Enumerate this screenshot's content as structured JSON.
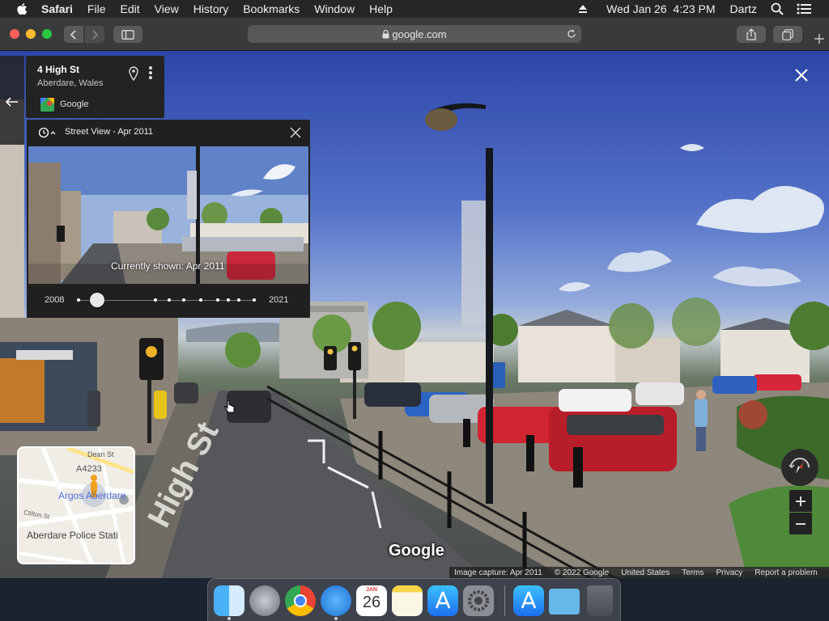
{
  "menubar": {
    "app_name": "Safari",
    "items": [
      "File",
      "Edit",
      "View",
      "History",
      "Bookmarks",
      "Window",
      "Help"
    ],
    "datetime": "Wed Jan 26  4:23 PM",
    "user": "Dartz"
  },
  "browser": {
    "url": "google.com"
  },
  "place_card": {
    "title": "4 High St",
    "subtitle": "Aberdare, Wales",
    "source": "Google"
  },
  "time_panel": {
    "title": "Street View - Apr 2011",
    "caption": "Currently shown: Apr 2011",
    "start_year": "2008",
    "end_year": "2021",
    "selected_fraction": 0.105
  },
  "scene": {
    "road_label": "High St",
    "watermark": "Google"
  },
  "minimap": {
    "label_street": "Dean St",
    "label_road": "A4233",
    "label_shop": "Argos Aberdare",
    "label_police": "Aberdare Police Stati",
    "label_clifton": "Clifton St"
  },
  "footer": {
    "capture": "Image capture: Apr 2011",
    "copyright": "© 2022 Google",
    "country": "United States",
    "terms": "Terms",
    "privacy": "Privacy",
    "report": "Report a problem"
  },
  "calendar_icon": {
    "month": "JAN",
    "day": "26"
  },
  "colors": {
    "menubar_bg": "#262626",
    "toolbar_bg": "#3a3a3a",
    "close": "#fe5f57",
    "minimize": "#febc2e",
    "zoom": "#28c840"
  }
}
